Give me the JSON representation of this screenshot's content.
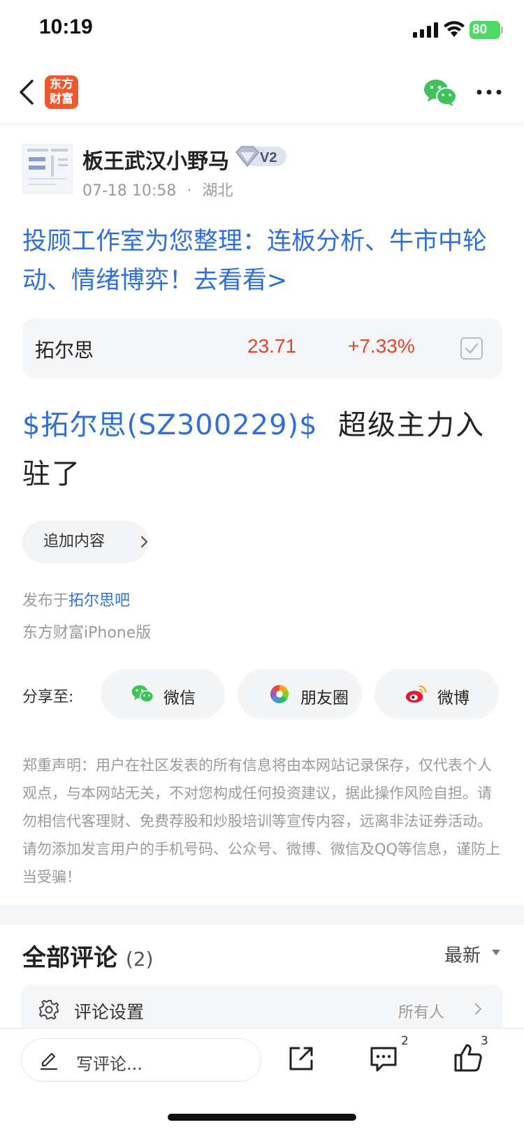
{
  "status_bar": {
    "time": "10:19",
    "battery": "80"
  },
  "nav": {
    "logo_line1": "东方",
    "logo_line2": "财富"
  },
  "author": {
    "name": "板王武汉小野马",
    "level": "V2",
    "date": "07-18 10:58",
    "separator": "·",
    "location": "湖北"
  },
  "promo": {
    "text": "投顾工作室为您整理：连板分析、牛市中轮动、情绪博弈！去看看>"
  },
  "stock": {
    "name": "拓尔思",
    "price": "23.71",
    "change": "+7.33%"
  },
  "post": {
    "stock_tag": "$拓尔思(SZ300229)$",
    "text": "  超级主力入驻了"
  },
  "append": {
    "label": "追加内容"
  },
  "publish": {
    "prefix": "发布于",
    "forum": "拓尔思吧",
    "source": "东方财富iPhone版"
  },
  "share": {
    "label": "分享至:",
    "items": [
      {
        "label": "微信"
      },
      {
        "label": "朋友圈"
      },
      {
        "label": "微博"
      }
    ]
  },
  "disclaimer": "郑重声明：用户在社区发表的所有信息将由本网站记录保存，仅代表个人观点，与本网站无关，不对您构成任何投资建议，据此操作风险自担。请勿相信代客理财、免费荐股和炒股培训等宣传内容，远离非法证券活动。请勿添加发言用户的手机号码、公众号、微博、微信及QQ等信息，谨防上当受骗！",
  "comments": {
    "title": "全部评论",
    "count": "(2)",
    "sort": "最新",
    "settings_label": "评论设置",
    "settings_value": "所有人"
  },
  "bottom_bar": {
    "placeholder": "写评论...",
    "comment_count": "2",
    "like_count": "3"
  },
  "colors": {
    "link_blue": "#2f6fdc",
    "price_red": "#e2452f",
    "brand_orange": "#f0582b",
    "wechat_green": "#3fc25b"
  }
}
